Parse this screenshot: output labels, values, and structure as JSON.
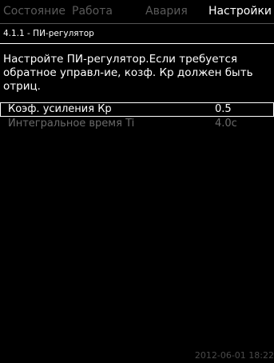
{
  "tabs": [
    {
      "label": "Состояние",
      "active": false
    },
    {
      "label": "Работа",
      "active": false
    },
    {
      "label": "Авария",
      "active": false
    },
    {
      "label": "Настройки",
      "active": true
    }
  ],
  "breadcrumb": "4.1.1 - ПИ-регулятор",
  "description": "Настройте ПИ-регулятор.Если требуется обратное управл-ие, козф. Кр должен быть отриц.",
  "parameters": [
    {
      "label": "Коэф. усиления Кр",
      "value": "0.5"
    },
    {
      "label": "Интегральное время Ti",
      "value": "4.0с"
    }
  ],
  "footer": {
    "datetime": "2012-06-01 18:22"
  },
  "colors": {
    "background": "#000000",
    "text": "#ffffff",
    "inactive": "#5a5a5a"
  }
}
